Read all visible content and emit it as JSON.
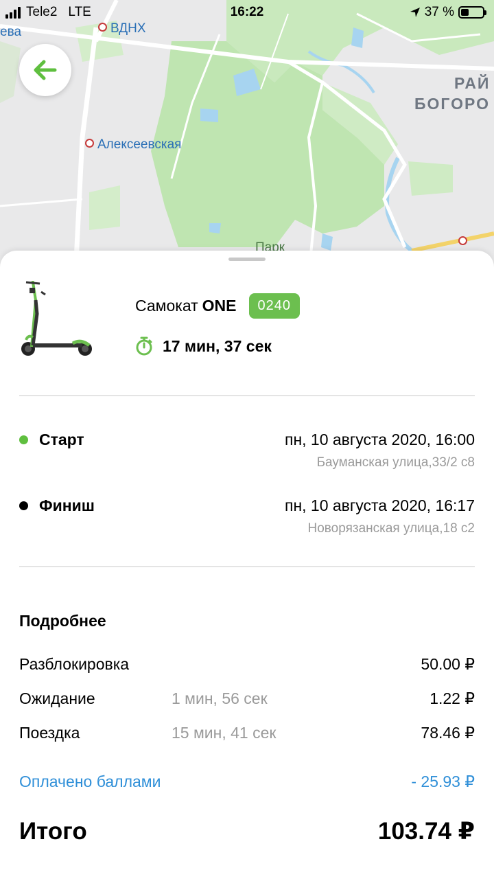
{
  "status_bar": {
    "carrier": "Tele2",
    "network": "LTE",
    "time": "16:22",
    "battery": "37 %",
    "battery_level": 0.37
  },
  "map": {
    "labels": {
      "vdnh": "ВДНХ",
      "alekseevskaya": "Алексеевская",
      "partial_left": "ева",
      "park": "Парк",
      "district_line1": "РАЙ",
      "district_line2": "БОГОРО"
    }
  },
  "back_button": {
    "icon": "arrow-left-icon",
    "color": "#5fbf3f"
  },
  "vehicle": {
    "type_label": "Самокат",
    "model": "ONE",
    "number": "0240",
    "duration": "17 мин, 37 сек",
    "accent": "#6cbf4f"
  },
  "trip": {
    "start": {
      "label": "Старт",
      "datetime": "пн, 10 августа 2020, 16:00",
      "address": "Бауманская улица,33/2 с8",
      "dot_color": "#5fbf3f"
    },
    "finish": {
      "label": "Финиш",
      "datetime": "пн, 10 августа 2020, 16:17",
      "address": "Новорязанская улица,18 с2",
      "dot_color": "#000000"
    }
  },
  "details": {
    "title": "Подробнее",
    "fees": [
      {
        "label": "Разблокировка",
        "duration": "",
        "amount": "50.00 ₽"
      },
      {
        "label": "Ожидание",
        "duration": "1 мин, 56 сек",
        "amount": "1.22 ₽"
      },
      {
        "label": "Поездка",
        "duration": "15 мин, 41 сек",
        "amount": "78.46 ₽"
      }
    ],
    "points": {
      "label": "Оплачено баллами",
      "amount": "- 25.93 ₽",
      "color": "#2f8fd8"
    },
    "total": {
      "label": "Итого",
      "amount": "103.74 ₽"
    }
  }
}
